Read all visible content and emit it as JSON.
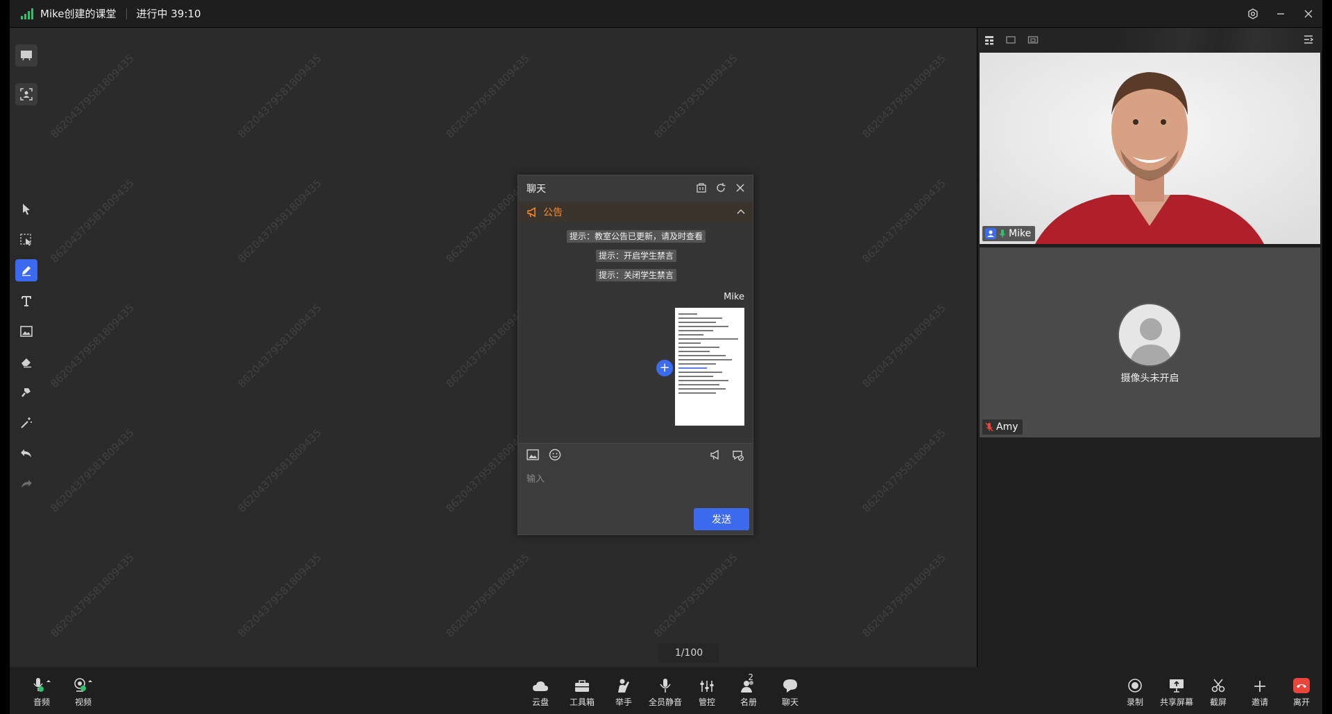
{
  "window": {
    "class_title": "Mike创建的课堂",
    "status": "进行中 39:10"
  },
  "board": {
    "watermark": "86204379581809435",
    "page": "1/100"
  },
  "chat": {
    "title": "聊天",
    "notice_label": "公告",
    "system_messages": [
      "提示：教室公告已更新，请及时查看",
      "提示：开启学生禁言",
      "提示：关闭学生禁言"
    ],
    "sender": "Mike",
    "input_placeholder": "输入",
    "send_label": "发送"
  },
  "videos": [
    {
      "name": "Mike"
    },
    {
      "name": "Amy",
      "camera_off_text": "摄像头未开启"
    }
  ],
  "bottombar": {
    "left": [
      {
        "label": "音频",
        "icon": "microphone-icon"
      },
      {
        "label": "视频",
        "icon": "camera-icon"
      }
    ],
    "center": [
      {
        "label": "云盘",
        "icon": "cloud-icon"
      },
      {
        "label": "工具箱",
        "icon": "toolbox-icon"
      },
      {
        "label": "举手",
        "icon": "raise-hand-icon"
      },
      {
        "label": "全员静音",
        "icon": "mute-all-icon"
      },
      {
        "label": "管控",
        "icon": "control-icon"
      },
      {
        "label": "名册",
        "icon": "roster-icon",
        "badge": "2"
      },
      {
        "label": "聊天",
        "icon": "chat-icon"
      }
    ],
    "right": [
      {
        "label": "录制",
        "icon": "record-icon"
      },
      {
        "label": "共享屏幕",
        "icon": "share-screen-icon"
      },
      {
        "label": "截屏",
        "icon": "screenshot-icon"
      },
      {
        "label": "邀请",
        "icon": "invite-icon"
      },
      {
        "label": "离开",
        "icon": "leave-icon"
      }
    ]
  },
  "colors": {
    "accent": "#3d6bf0",
    "notice": "#ff8c2e",
    "signal": "#31c26b",
    "leave": "#e8453c"
  }
}
